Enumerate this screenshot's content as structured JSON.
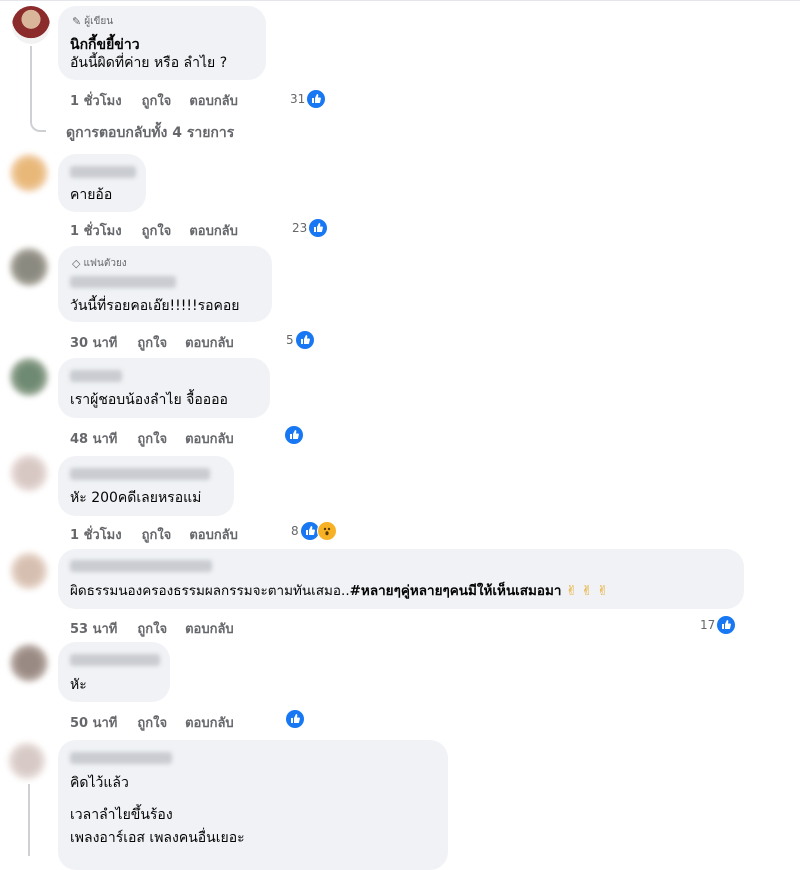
{
  "badges": {
    "author": "ผู้เขียน",
    "top_fan": "แฟนตัวยง"
  },
  "actions": {
    "like": "ถูกใจ",
    "reply": "ตอบกลับ"
  },
  "view_replies": "ดูการตอบกลับทั้ง 4 รายการ",
  "comments": [
    {
      "name": "นิกกี้ขยี้ข่าว",
      "text": "อันนี้ผิดที่ค่าย หรือ ลำไย ?",
      "time": "1 ชั่วโมง",
      "reactions": "31"
    },
    {
      "text": "คายอ้อ",
      "time": "1 ชั่วโมง",
      "reactions": "23"
    },
    {
      "text": "วันนี้ที่รอยคอเอ๊ย!!!!!รอคอย",
      "time": "30 นาที",
      "reactions": "5"
    },
    {
      "text": "เราผู้ชอบน้องลำไย จื้ออออ",
      "time": "48 นาที",
      "reactions": ""
    },
    {
      "text": "หัะ 200คดีเลยหรอแม่",
      "time": "1 ชั่วโมง",
      "reactions": "8"
    },
    {
      "text": "ผิดธรรมนองครองธรรมผลกรรมจะตามทันเสมอ..",
      "hashtag": "#หลายๆคู่หลายๆคนมีให้เห็นเสมอมา",
      "emoji": "✌ ✌ ✌",
      "time": "53 นาที",
      "reactions": "17"
    },
    {
      "text": "หัะ",
      "time": "50 นาที",
      "reactions": ""
    },
    {
      "line1": "คิดไว้แล้ว",
      "line2": "เวลาลำไยขึ้นร้อง",
      "line3": "เพลงอาร์เอส เพลงคนอื่นเยอะ"
    }
  ],
  "colors": {
    "accent": "#1877f2",
    "bubble": "#f0f2f5",
    "muted": "#65676b"
  }
}
